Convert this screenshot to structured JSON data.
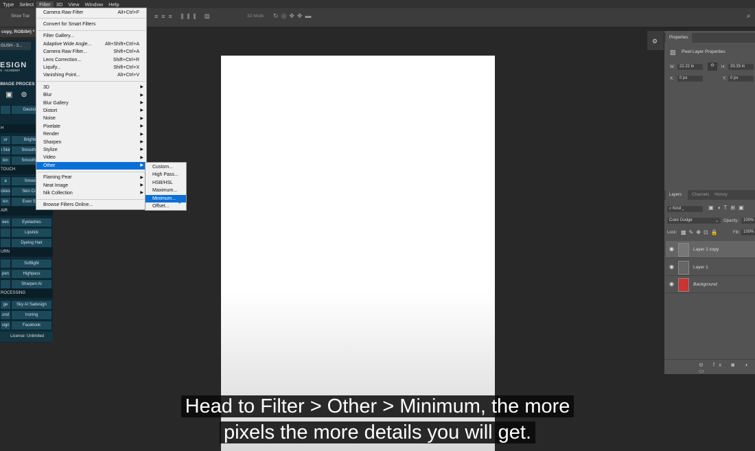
{
  "menubar": [
    "Type",
    "Select",
    "Filter",
    "3D",
    "View",
    "Window",
    "Help"
  ],
  "options": {
    "show_transform": "Show Trar",
    "mode_3d": "3D Mode:"
  },
  "doc_title": "copy, RGB/8#) *",
  "left_panel": {
    "tab": "GUSH - 3...",
    "logo": "ESIGN",
    "logo_sub": "S - ACADEMY",
    "header": "IMAGE PROCES",
    "rows": [
      {
        "type": "btn",
        "cells": [
          "",
          "Gaussian"
        ]
      },
      {
        "type": "sec",
        "label": "H"
      },
      {
        "type": "btn",
        "cells": [
          "ur",
          "Brighten"
        ]
      },
      {
        "type": "btn",
        "cells": [
          "n Skin",
          "Smooth Sk"
        ]
      },
      {
        "type": "btn",
        "cells": [
          "kin",
          "Smooth Sk"
        ]
      },
      {
        "type": "sec",
        "label": "TOUCH"
      },
      {
        "type": "btn",
        "cells": [
          "a",
          "Smooth"
        ]
      },
      {
        "type": "btn",
        "cells": [
          "ckles",
          "Skin Color"
        ]
      },
      {
        "type": "btn",
        "cells": [
          "kin",
          "Even Skin"
        ]
      },
      {
        "type": "sec",
        "label": "AIR"
      },
      {
        "type": "btn",
        "cells": [
          "ees",
          "Eyelashes"
        ]
      },
      {
        "type": "btn",
        "cells": [
          "",
          "Lipstick"
        ]
      },
      {
        "type": "btn",
        "cells": [
          "",
          "Dyeing Hair"
        ]
      },
      {
        "type": "sec",
        "label": "URN"
      },
      {
        "type": "btn",
        "cells": [
          "",
          "Softlight"
        ]
      },
      {
        "type": "btn",
        "cells": [
          "pen",
          "Highpass"
        ]
      },
      {
        "type": "btn",
        "cells": [
          "",
          "Sharpen AI"
        ]
      },
      {
        "type": "sec",
        "label": "ROCESSING"
      },
      {
        "type": "btn",
        "cells": [
          "ge",
          "Sky AI Sadesign"
        ]
      },
      {
        "type": "btn",
        "cells": [
          "und",
          "Ironing"
        ]
      },
      {
        "type": "btn",
        "cells": [
          "sign",
          "Facebook"
        ]
      }
    ],
    "license": "License: Unlimited"
  },
  "filter_menu": {
    "items": [
      {
        "label": "Camera Raw Filter",
        "shortcut": "Alt+Ctrl+F"
      },
      {
        "sep": true
      },
      {
        "label": "Convert for Smart Filters"
      },
      {
        "sep": true
      },
      {
        "label": "Filter Gallery..."
      },
      {
        "label": "Adaptive Wide Angle...",
        "shortcut": "Alt+Shift+Ctrl+A"
      },
      {
        "label": "Camera Raw Filter...",
        "shortcut": "Shift+Ctrl+A"
      },
      {
        "label": "Lens Correction...",
        "shortcut": "Shift+Ctrl+R"
      },
      {
        "label": "Liquify...",
        "shortcut": "Shift+Ctrl+X"
      },
      {
        "label": "Vanishing Point...",
        "shortcut": "Alt+Ctrl+V"
      },
      {
        "sep": true
      },
      {
        "label": "3D",
        "sub": true
      },
      {
        "label": "Blur",
        "sub": true
      },
      {
        "label": "Blur Gallery",
        "sub": true
      },
      {
        "label": "Distort",
        "sub": true
      },
      {
        "label": "Noise",
        "sub": true
      },
      {
        "label": "Pixelate",
        "sub": true
      },
      {
        "label": "Render",
        "sub": true
      },
      {
        "label": "Sharpen",
        "sub": true
      },
      {
        "label": "Stylize",
        "sub": true
      },
      {
        "label": "Video",
        "sub": true
      },
      {
        "label": "Other",
        "sub": true,
        "highlighted": true
      },
      {
        "sep": true
      },
      {
        "label": "Flaming Pear",
        "sub": true
      },
      {
        "label": "Neat Image",
        "sub": true
      },
      {
        "label": "Nik Collection",
        "sub": true
      },
      {
        "sep": true
      },
      {
        "label": "Browse Filters Online..."
      }
    ]
  },
  "other_submenu": {
    "items": [
      {
        "label": "Custom..."
      },
      {
        "label": "High Pass..."
      },
      {
        "label": "HSB/HSL"
      },
      {
        "label": "Maximum..."
      },
      {
        "label": "Minimum...",
        "highlighted": true
      },
      {
        "label": "Offset..."
      }
    ]
  },
  "properties": {
    "tab": "Properties",
    "title": "Pixel Layer Properties",
    "w_label": "W:",
    "w": "22.22 in",
    "h_label": "H:",
    "h": "33.33 in",
    "x_label": "X:",
    "x": "0 px",
    "y_label": "Y:",
    "y": "0 px"
  },
  "layers": {
    "tabs": [
      "Layers",
      "Channels",
      "History"
    ],
    "kind": "Kind",
    "blend": "Color Dodge",
    "opacity_label": "Opacity:",
    "opacity": "100%",
    "lock_label": "Lock:",
    "fill_label": "Fill:",
    "fill": "100%",
    "items": [
      {
        "name": "Layer 1 copy",
        "selected": true
      },
      {
        "name": "Layer 1"
      },
      {
        "name": "Background",
        "italic": true
      }
    ]
  },
  "caption": [
    "Head to Filter > Other > Minimum, the more",
    "pixels the more details you will get."
  ],
  "colors": {
    "highlight": "#0a6fd6",
    "plugin_panel": "#0f2a36"
  }
}
